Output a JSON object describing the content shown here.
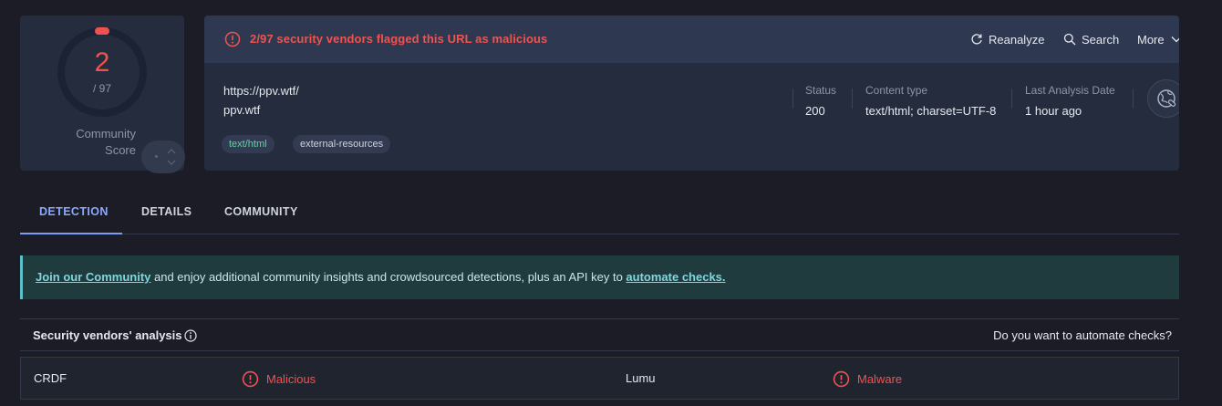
{
  "score": {
    "detections": "2",
    "total": "/ 97",
    "fraction_flagged": 0.0206,
    "accent_color": "#ef5350",
    "community_label_line1": "Community",
    "community_label_line2": "Score"
  },
  "header": {
    "alert_icon": "alert-circle-icon",
    "alert_text": "2/97 security vendors flagged this URL as malicious",
    "reanalyze_label": "Reanalyze",
    "search_label": "Search",
    "more_label": "More"
  },
  "url": {
    "full": "https://ppv.wtf/",
    "host": "ppv.wtf",
    "tags": [
      "text/html",
      "external-resources"
    ]
  },
  "meta": {
    "status_label": "Status",
    "status_value": "200",
    "content_type_label": "Content type",
    "content_type_value": "text/html; charset=UTF-8",
    "last_analysis_label": "Last Analysis Date",
    "last_analysis_value": "1 hour ago"
  },
  "tabs": [
    {
      "label": "DETECTION",
      "active": true
    },
    {
      "label": "DETAILS",
      "active": false
    },
    {
      "label": "COMMUNITY",
      "active": false
    }
  ],
  "banner": {
    "link1": "Join our Community",
    "middle": " and enjoy additional community insights and crowdsourced detections, plus an API key to ",
    "link2": "automate checks."
  },
  "analysis": {
    "title": "Security vendors' analysis",
    "automate_question": "Do you want to automate checks?",
    "rows": [
      {
        "vendor1": "CRDF",
        "verdict1": "Malicious",
        "vendor2": "Lumu",
        "verdict2": "Malware"
      }
    ]
  }
}
